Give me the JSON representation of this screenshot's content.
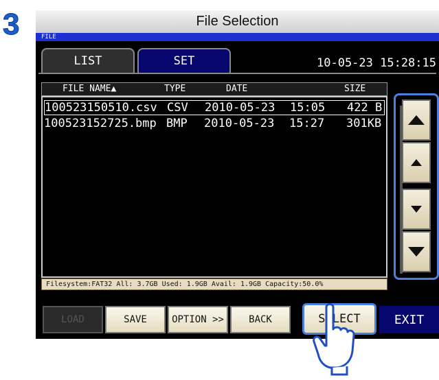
{
  "step_number": "3",
  "title": "File Selection",
  "screen_label": "FILE",
  "tabs": [
    {
      "label": "LIST",
      "active": true
    },
    {
      "label": "SET",
      "active": false
    }
  ],
  "clock": "10-05-23 15:28:15",
  "columns": {
    "name": "FILE NAME▲",
    "type": "TYPE",
    "date": "DATE",
    "size": "SIZE"
  },
  "files": [
    {
      "name": "100523150510.csv",
      "type": "CSV",
      "date": "2010-05-23",
      "time": "15:05",
      "size": "422 B"
    },
    {
      "name": "100523152725.bmp",
      "type": "BMP",
      "date": "2010-05-23",
      "time": "15:27",
      "size": "301KB"
    }
  ],
  "filesystem_info": "Filesystem:FAT32 All: 3.7GB Used: 1.9GB Avail: 1.9GB Capacity:50.0%",
  "buttons": {
    "load": "LOAD",
    "save": "SAVE",
    "option": "OPTION >>",
    "back": "BACK",
    "select": "SELECT",
    "exit": "EXIT"
  },
  "scroll_icons": [
    "page-up-icon",
    "line-up-icon",
    "line-down-icon",
    "page-down-icon"
  ],
  "colors": {
    "accent": "#4d7fe0",
    "screen_bg": "#000000",
    "tab_active": "#2f2f2f",
    "tab_inactive": "#06066e",
    "button_face": "#f3eedb"
  }
}
